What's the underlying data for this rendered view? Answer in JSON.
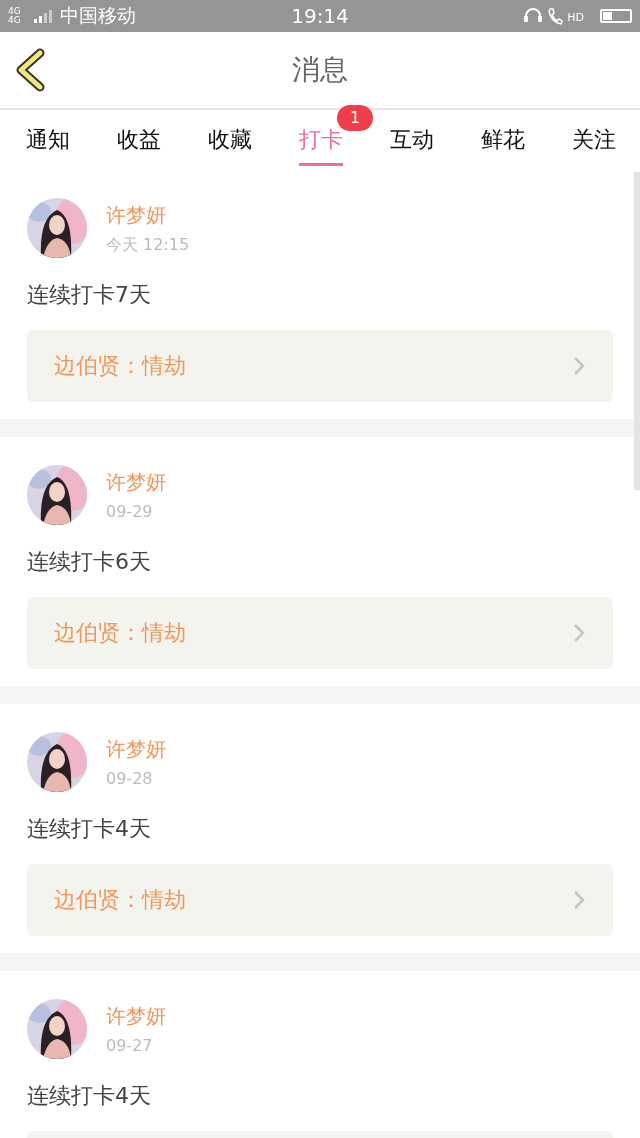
{
  "status_bar": {
    "network_labels": [
      "4G",
      "4G"
    ],
    "carrier": "中国移动",
    "time": "19:14",
    "call_label": "HD"
  },
  "header": {
    "title": "消息"
  },
  "tabs": [
    {
      "label": "通知",
      "selected": false
    },
    {
      "label": "收益",
      "selected": false
    },
    {
      "label": "收藏",
      "selected": false
    },
    {
      "label": "打卡",
      "selected": true,
      "badge": "1"
    },
    {
      "label": "互动",
      "selected": false
    },
    {
      "label": "鲜花",
      "selected": false
    },
    {
      "label": "关注",
      "selected": false
    }
  ],
  "messages": [
    {
      "name": "许梦妍",
      "time": "今天 12:15",
      "text": "连续打卡7天",
      "link": "边伯贤：情劫"
    },
    {
      "name": "许梦妍",
      "time": "09-29",
      "text": "连续打卡6天",
      "link": "边伯贤：情劫"
    },
    {
      "name": "许梦妍",
      "time": "09-28",
      "text": "连续打卡4天",
      "link": "边伯贤：情劫"
    },
    {
      "name": "许梦妍",
      "time": "09-27",
      "text": "连续打卡4天"
    }
  ]
}
